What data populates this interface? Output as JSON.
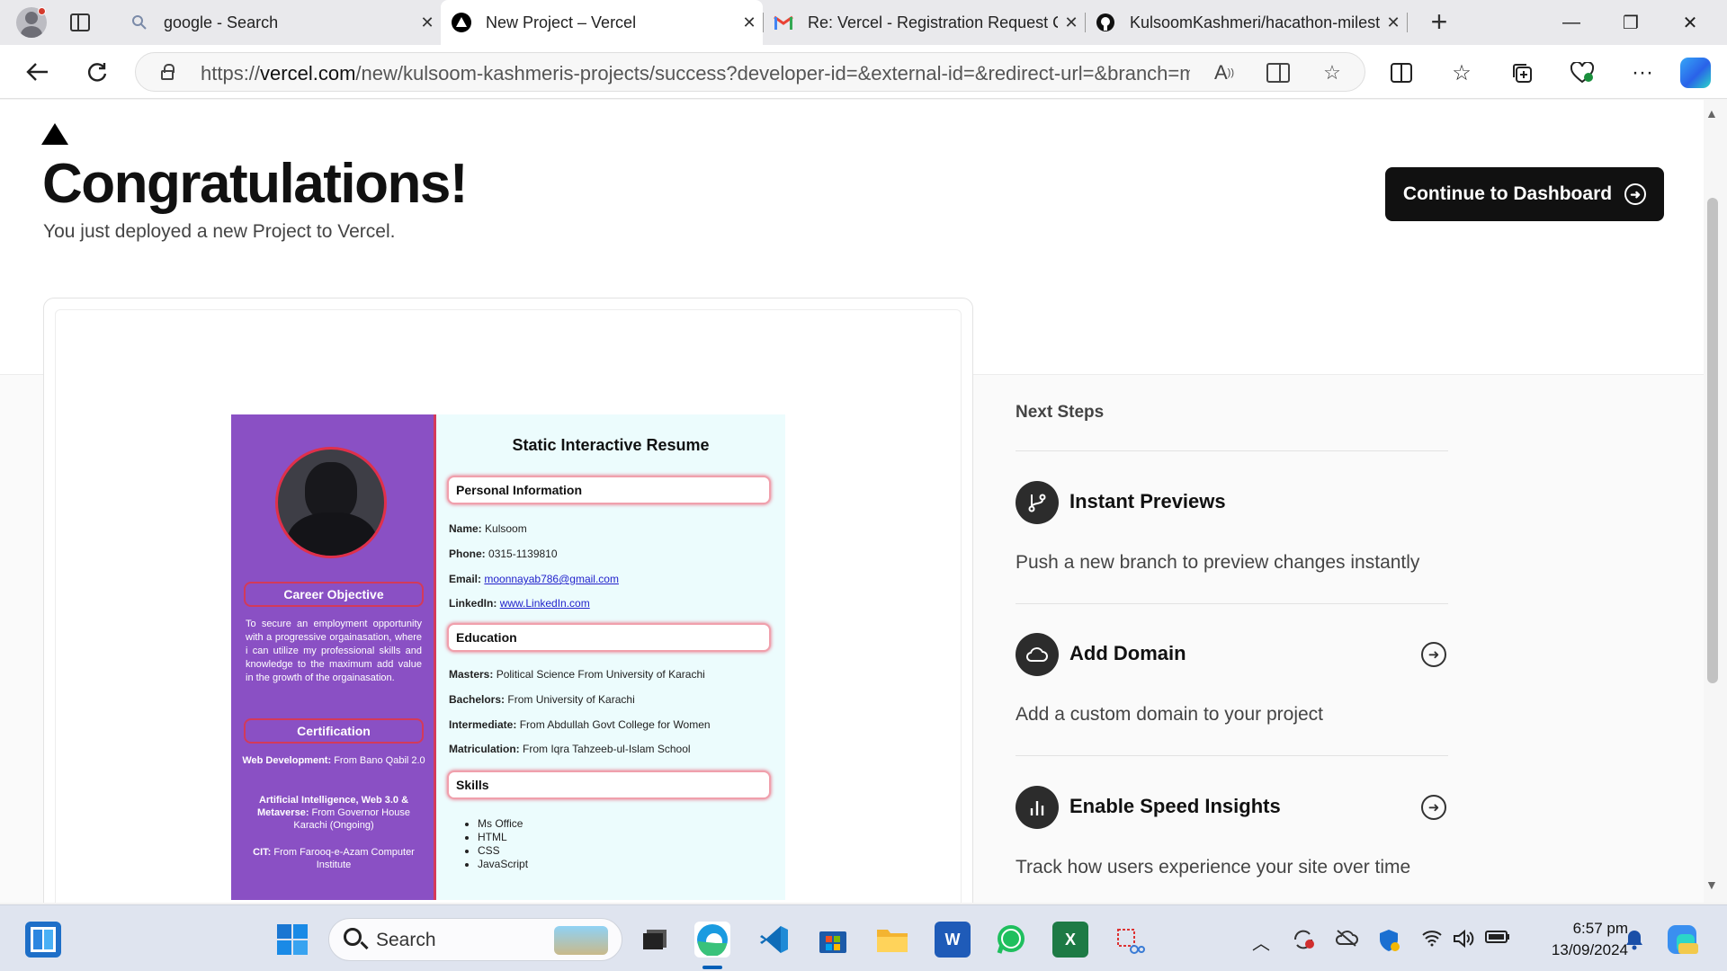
{
  "browser": {
    "tabs": [
      {
        "title": "google - Search",
        "icon": "search-icon",
        "active": false
      },
      {
        "title": "New Project – Vercel",
        "icon": "vercel-icon",
        "active": true
      },
      {
        "title": "Re: Vercel - Registration Request C",
        "icon": "gmail-icon",
        "active": false
      },
      {
        "title": "KulsoomKashmeri/hacathon-milest",
        "icon": "github-icon",
        "active": false
      }
    ],
    "url_prefix": "https://",
    "url_domain": "vercel.com",
    "url_path": "/new/kulsoom-kashmeris-projects/success?developer-id=&external-id=&redirect-url=&branch=m..."
  },
  "page": {
    "heading": "Congratulations!",
    "subtitle": "You just deployed a new Project to Vercel.",
    "dashboard_button": "Continue to Dashboard",
    "next_steps_title": "Next Steps",
    "steps": [
      {
        "title": "Instant Previews",
        "desc": "Push a new branch to preview changes instantly",
        "icon": "git-branch-icon"
      },
      {
        "title": "Add Domain",
        "desc": "Add a custom domain to your project",
        "icon": "cloud-icon"
      },
      {
        "title": "Enable Speed Insights",
        "desc": "Track how users experience your site over time",
        "icon": "bar-chart-icon"
      }
    ]
  },
  "resume": {
    "title": "Static Interactive Resume",
    "sections": {
      "personal": "Personal Information",
      "education": "Education",
      "skills": "Skills",
      "career": "Career Objective",
      "certification": "Certification"
    },
    "personal": {
      "name_label": "Name:",
      "name": "Kulsoom",
      "phone_label": "Phone:",
      "phone": "0315-1139810",
      "email_label": "Email:",
      "email": "moonnayab786@gmail.com",
      "linkedin_label": "LinkedIn:",
      "linkedin": "www.LinkedIn.com"
    },
    "education": {
      "masters_label": "Masters:",
      "masters": "Political Science From University of Karachi",
      "bachelors_label": "Bachelors:",
      "bachelors": "From University of Karachi",
      "intermediate_label": "Intermediate:",
      "intermediate": "From Abdullah Govt College for Women",
      "matric_label": "Matriculation:",
      "matric": "From Iqra Tahzeeb-ul-Islam School"
    },
    "career_text": "To secure an employment opportunity with a progressive orgainasation, where i can utilize my professional skills and knowledge to the maximum add value in the growth of the orgainasation.",
    "certs": [
      {
        "label": "Web Development:",
        "text": "From Bano Qabil 2.0"
      },
      {
        "label": "Artificial Intelligence, Web 3.0 & Metaverse:",
        "text": "From Governor House Karachi (Ongoing)"
      },
      {
        "label": "CIT:",
        "text": "From Farooq-e-Azam Computer Institute"
      }
    ],
    "skills": [
      "Ms Office",
      "HTML",
      "CSS",
      "JavaScript"
    ]
  },
  "taskbar": {
    "search_placeholder": "Search",
    "time": "6:57 pm",
    "date": "13/09/2024"
  },
  "colors": {
    "resume_sidebar": "#8a50c4",
    "resume_accent": "#d43a5a",
    "resume_main_bg": "#ecfcfd",
    "button_dark": "#111111"
  }
}
